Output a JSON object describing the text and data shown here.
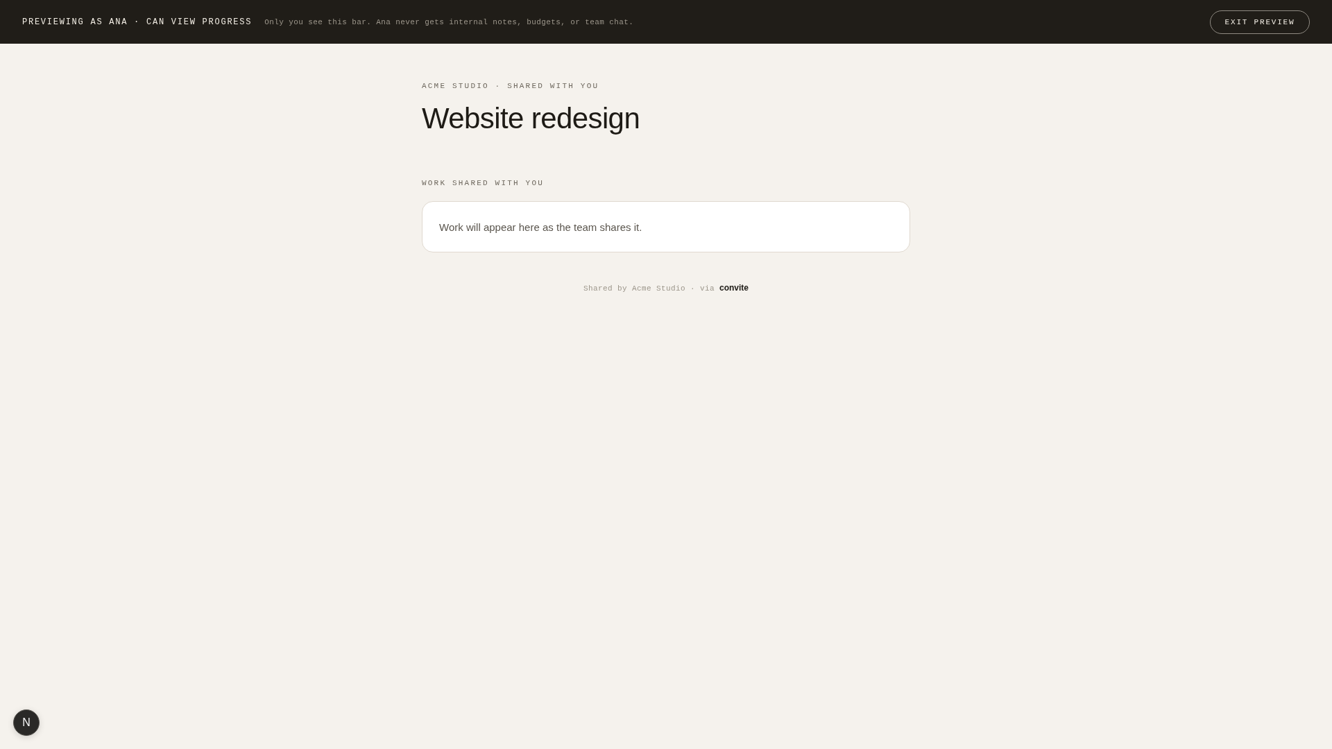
{
  "preview_bar": {
    "label": "PREVIEWING AS ANA · CAN VIEW PROGRESS",
    "note": "Only you see this bar. Ana never gets internal notes, budgets, or team chat.",
    "exit_button": "EXIT PREVIEW"
  },
  "header": {
    "eyebrow": "ACME STUDIO · SHARED WITH YOU",
    "title": "Website redesign"
  },
  "shared_work": {
    "heading": "WORK SHARED WITH YOU",
    "empty_message": "Work will appear here as the team shares it."
  },
  "footer": {
    "text": "Shared by Acme Studio · via",
    "link": "convite"
  },
  "dev_indicator": {
    "label": "N"
  }
}
